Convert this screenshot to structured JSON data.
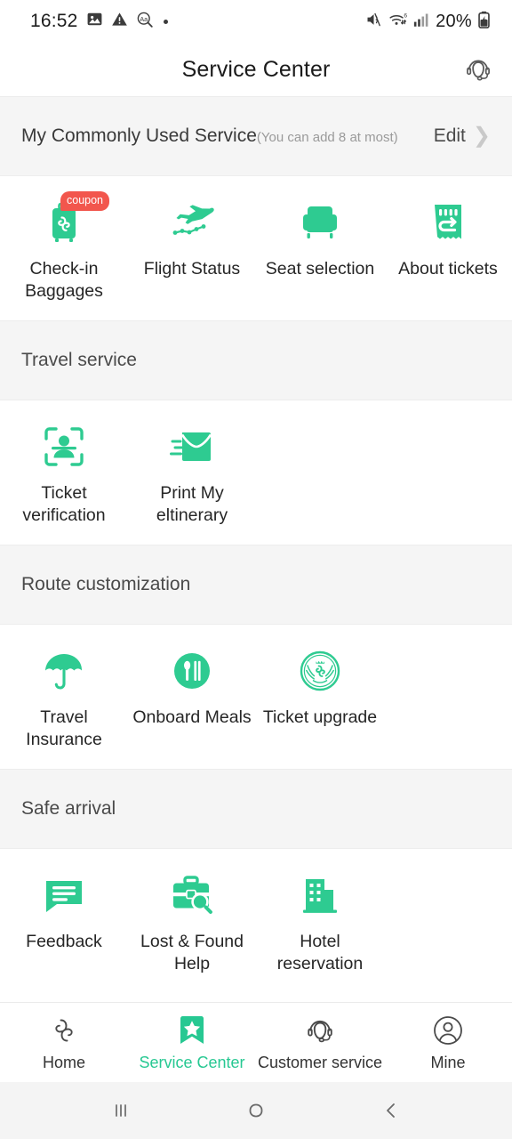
{
  "theme": {
    "accent": "#27c892",
    "badge_red": "#f2564d",
    "section_bg": "#f5f5f5",
    "text": "#262626"
  },
  "status_bar": {
    "time": "16:52",
    "battery_percent": "20%",
    "icons": [
      "image-icon",
      "warning-triangle-icon",
      "text-zoom-icon",
      "dot-indicator-icon",
      "volume-mute-icon",
      "wifi-6-icon",
      "cellular-signal-icon",
      "battery-charging-icon"
    ]
  },
  "header": {
    "title": "Service Center",
    "action_icon": "headset-support-icon"
  },
  "commonly_used": {
    "title": "My Commonly Used Service",
    "subtitle": "(You can add 8 at most)",
    "edit_label": "Edit",
    "items": [
      {
        "label": "Check-in Baggages",
        "icon": "baggage-icon",
        "badge": "coupon"
      },
      {
        "label": "Flight Status",
        "icon": "airplane-track-icon",
        "badge": ""
      },
      {
        "label": "Seat selection",
        "icon": "armchair-seat-icon",
        "badge": ""
      },
      {
        "label": "About tickets",
        "icon": "ticket-refund-icon",
        "badge": ""
      }
    ]
  },
  "sections": [
    {
      "title": "Travel service",
      "items": [
        {
          "label": "Ticket verification",
          "icon": "id-scan-icon"
        },
        {
          "label": "Print My eltinerary",
          "icon": "envelope-mail-icon"
        }
      ]
    },
    {
      "title": "Route customization",
      "items": [
        {
          "label": "Travel Insurance",
          "icon": "umbrella-icon"
        },
        {
          "label": "Onboard Meals",
          "icon": "cutlery-circle-icon"
        },
        {
          "label": "Ticket upgrade",
          "icon": "airline-seal-icon"
        }
      ]
    },
    {
      "title": "Safe arrival",
      "items": [
        {
          "label": "Feedback",
          "icon": "chat-lines-icon"
        },
        {
          "label": "Lost & Found Help",
          "icon": "briefcase-search-icon"
        },
        {
          "label": "Hotel reservation",
          "icon": "hotel-building-icon"
        }
      ]
    }
  ],
  "tabbar": {
    "active_index": 1,
    "items": [
      {
        "label": "Home",
        "icon": "spiral-logo-icon"
      },
      {
        "label": "Service Center",
        "icon": "bookmark-star-icon"
      },
      {
        "label": "Customer service",
        "icon": "headset-icon"
      },
      {
        "label": "Mine",
        "icon": "person-circle-icon"
      }
    ]
  },
  "android_nav": {
    "items": [
      {
        "icon": "recents-icon"
      },
      {
        "icon": "home-circle-icon"
      },
      {
        "icon": "back-chevron-icon"
      }
    ]
  }
}
